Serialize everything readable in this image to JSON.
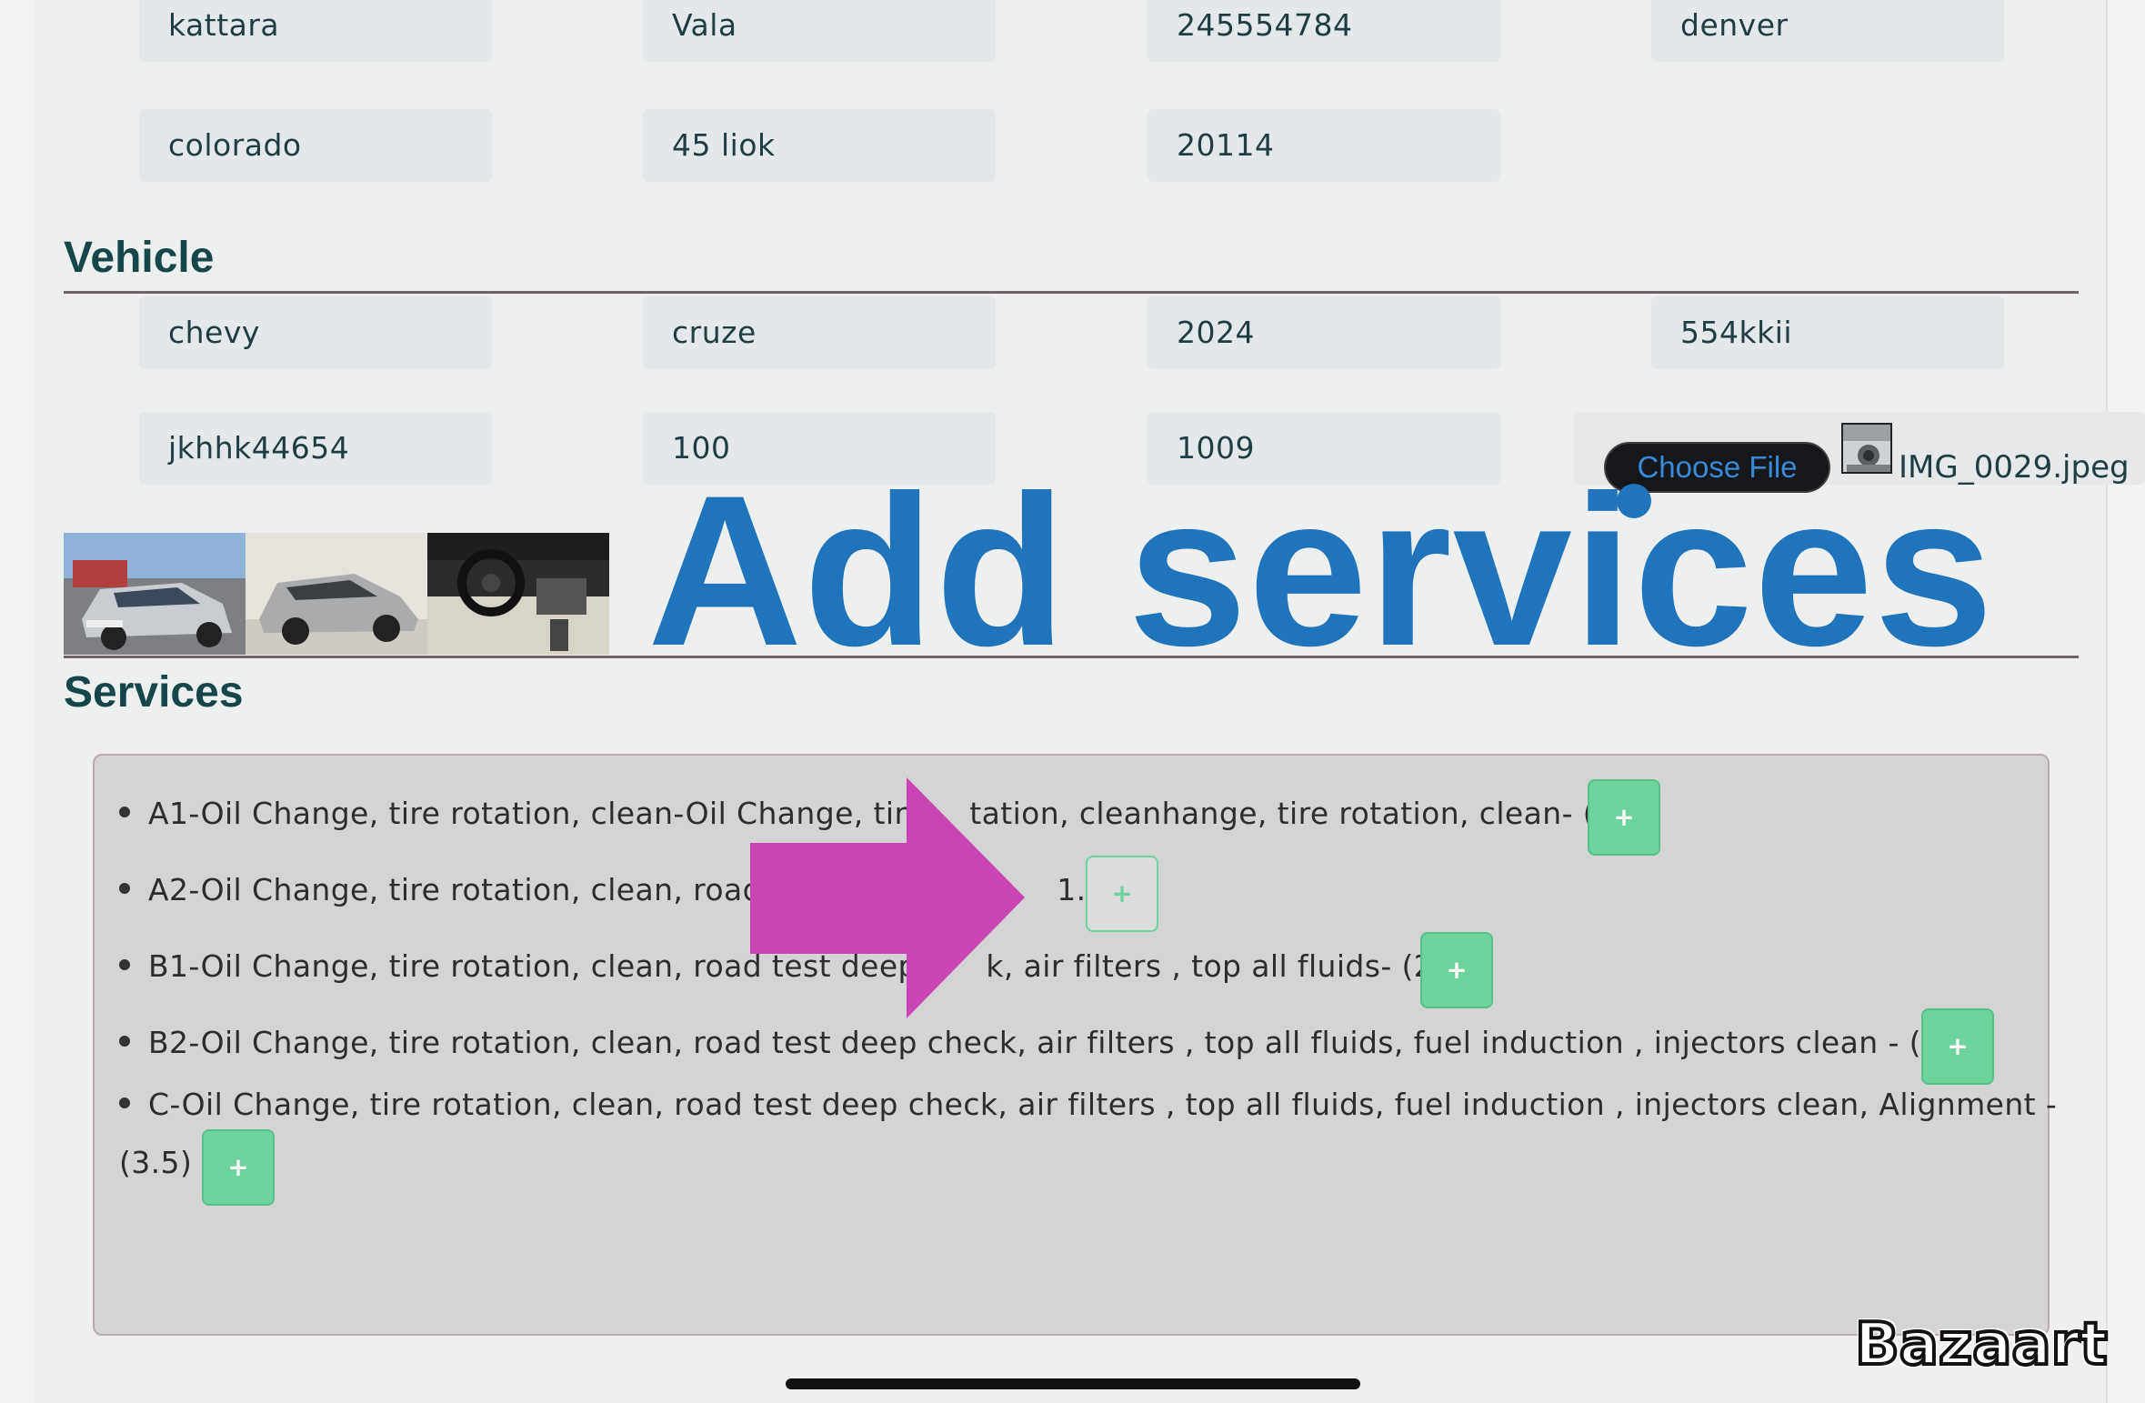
{
  "owner_fields": {
    "row1": [
      "kattara",
      "Vala",
      "245554784",
      "denver"
    ],
    "row2": [
      "colorado",
      "45 liok",
      "20114"
    ]
  },
  "vehicle": {
    "heading": "Vehicle",
    "row1": [
      "chevy",
      "cruze",
      "2024",
      "554kkii"
    ],
    "row2": [
      "jkhhk44654",
      "100",
      "1009"
    ],
    "choose_file_label": "Choose File",
    "file_name": "IMG_0029.jpeg"
  },
  "overlay_title": "Add services",
  "services": {
    "heading": "Services",
    "items": [
      {
        "text": "A1-Oil Change, tire rotation, clean-Oil Change, tire rotation, cleanhange, tire rotation, clean- (.8)",
        "visible": "A1-Oil Change, tire rotation, clean-Oil Change, tire ",
        "tail": "tation, cleanhange, tire rotation, clean- (.8)"
      },
      {
        "text": "A2-Oil Change, tire rotation, clean, road test (1.2)",
        "visible": "A2-Oil Change, tire rotation, clean, road t",
        "tail": "1.2)"
      },
      {
        "text": "B1-Oil Change, tire rotation, clean, road test deep check, air filters , top all fluids- (2)",
        "visible": "B1-Oil Change, tire rotation, clean, road test deep c",
        "tail": "k, air filters , top all fluids- (2)"
      },
      {
        "text": "B2-Oil Change, tire rotation, clean, road test deep check, air filters , top all fluids, fuel induction , injectors clean - (2.5)"
      },
      {
        "line1": "C-Oil Change, tire rotation, clean, road test deep check, air filters , top all fluids, fuel induction , injectors clean, Alignment -",
        "line2": "(3.5)"
      }
    ],
    "add_label": "+"
  },
  "watermark": "Bazaart",
  "colors": {
    "accent_blue": "#1f74bb",
    "add_green": "#6cd39c",
    "arrow_magenta": "#c944b4",
    "heading_teal": "#16464a"
  }
}
